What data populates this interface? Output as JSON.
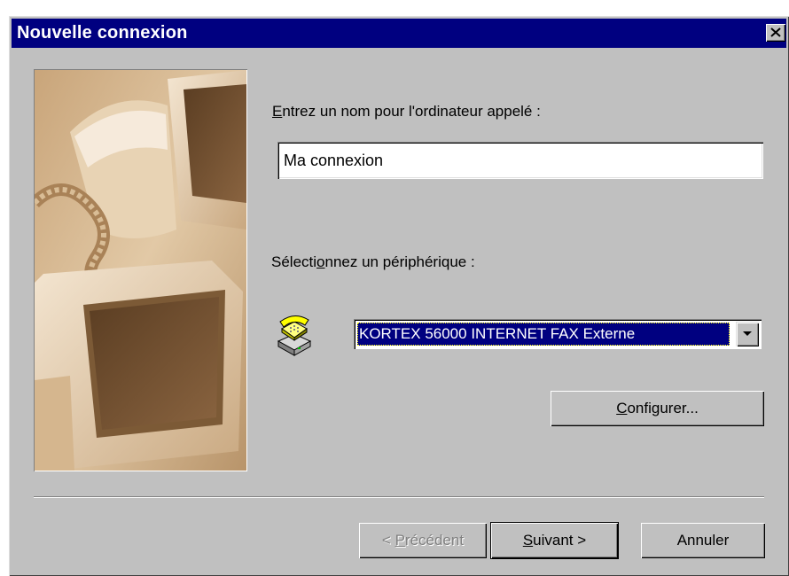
{
  "window": {
    "title": "Nouvelle connexion"
  },
  "form": {
    "name_label_access": "E",
    "name_label_rest": "ntrez un nom pour l'ordinateur appelé :",
    "name_value": "Ma connexion",
    "device_label_pre": "Sélecti",
    "device_label_access": "o",
    "device_label_post": "nnez un périphérique :",
    "device_selected": "KORTEX 56000 INTERNET FAX Externe",
    "configure_access": "C",
    "configure_rest": "onfigurer..."
  },
  "buttons": {
    "back_pre": "< ",
    "back_access": "P",
    "back_rest": "récédent",
    "next_access": "S",
    "next_rest": "uivant >",
    "cancel": "Annuler"
  },
  "icons": {
    "close": "close-icon",
    "phone": "telephone-modem-icon",
    "dropdown": "chevron-down-icon"
  },
  "colors": {
    "titlebar": "#000080",
    "face": "#c0c0c0",
    "selection": "#000080"
  }
}
